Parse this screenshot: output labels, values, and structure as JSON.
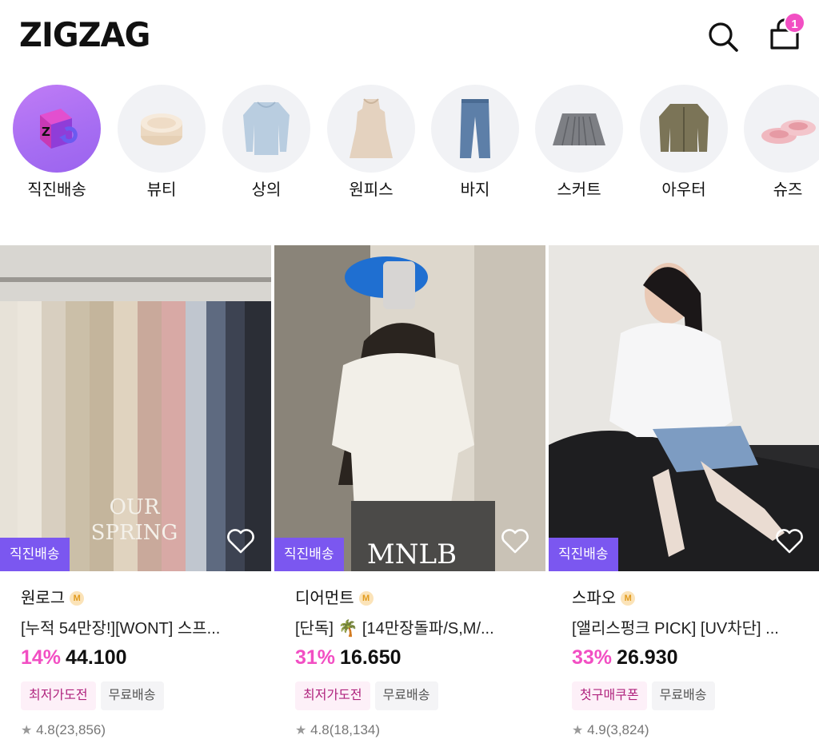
{
  "header": {
    "logo": "ZIGZAG",
    "cart_count": "1"
  },
  "categories": [
    {
      "label": "직진배송",
      "icon": "zigzag-direct-box-icon",
      "active": true
    },
    {
      "label": "뷰티",
      "icon": "cushion-compact-icon"
    },
    {
      "label": "상의",
      "icon": "knit-top-icon"
    },
    {
      "label": "원피스",
      "icon": "dress-icon"
    },
    {
      "label": "바지",
      "icon": "jeans-icon"
    },
    {
      "label": "스커트",
      "icon": "pleated-skirt-icon"
    },
    {
      "label": "아우터",
      "icon": "jacket-icon"
    },
    {
      "label": "슈즈",
      "icon": "ballet-flats-icon"
    }
  ],
  "products": [
    {
      "badge": "직진배송",
      "image_text": [
        "OUR",
        "SPRING"
      ],
      "shop": "원로그",
      "shop_badge": "M",
      "title": "[누적 54만장!][WONT] 스프...",
      "discount": "14%",
      "price": "44.100",
      "tags": [
        "최저가도전",
        "무료배송"
      ],
      "rating": "4.8",
      "reviews": "(23,856)"
    },
    {
      "badge": "직진배송",
      "image_text": [
        "MNLB"
      ],
      "shop": "디어먼트",
      "shop_badge": "M",
      "title": "[단독] 🌴 [14만장돌파/S,M/...",
      "discount": "31%",
      "price": "16.650",
      "tags": [
        "최저가도전",
        "무료배송"
      ],
      "rating": "4.8",
      "reviews": "(18,134)"
    },
    {
      "badge": "직진배송",
      "image_text": [],
      "shop": "스파오",
      "shop_badge": "M",
      "title": "[앨리스펑크 PICK] [UV차단] ...",
      "discount": "33%",
      "price": "26.930",
      "tags": [
        "첫구매쿠폰",
        "무료배송"
      ],
      "rating": "4.9",
      "reviews": "(3,824)"
    }
  ],
  "colors": {
    "accent_pink": "#f24fc3",
    "direct_purple": "#7b57f0"
  }
}
